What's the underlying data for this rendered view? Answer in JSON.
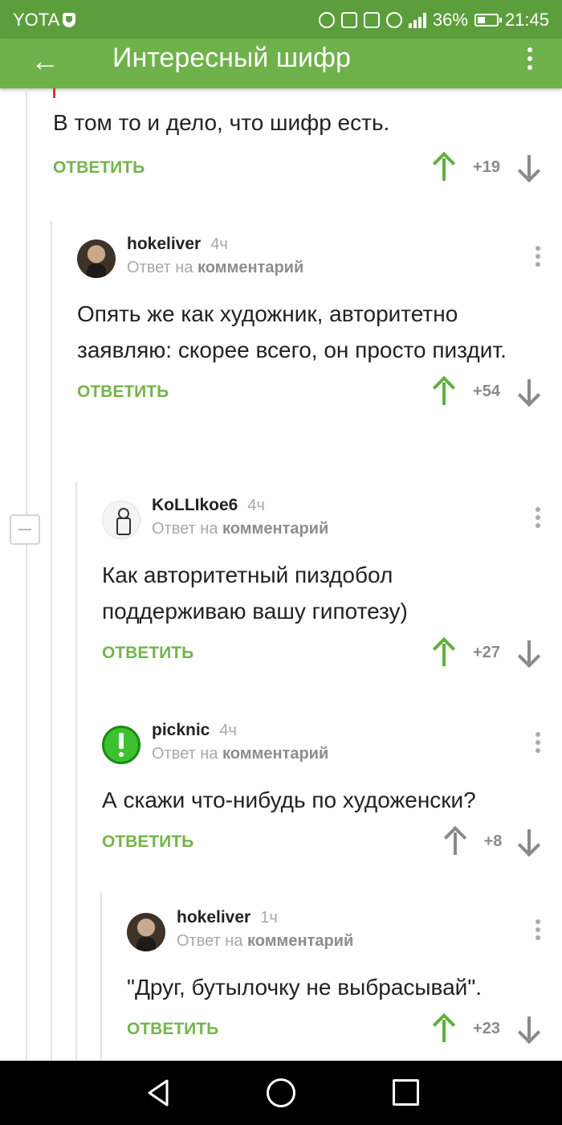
{
  "status_bar": {
    "carrier": "YOTA",
    "battery": "36%",
    "battery_level": 0.36,
    "time": "21:45",
    "icons": [
      "shield-icon",
      "headphones-icon",
      "nfc-icon",
      "vibrate-icon",
      "alarm-icon",
      "signal-4g-icon",
      "battery-icon"
    ]
  },
  "app_bar": {
    "title": "Интересный шифр",
    "back_icon": "arrow-left-icon",
    "more_icon": "more-vertical-icon"
  },
  "top_comment": {
    "text": "В том то и дело, что шифр есть.",
    "reply_label": "ОТВЕТИТЬ",
    "score": "+19",
    "upvote_color": "#5fb13a"
  },
  "comments": [
    {
      "username": "hokeliver",
      "time": "4ч",
      "reply_prefix": "Ответ на",
      "reply_target": "комментарий",
      "text": "Опять же как художник, авторитетно заявляю: скорее всего, он просто пиздит.",
      "reply_label": "ОТВЕТИТЬ",
      "score": "+54"
    },
    {
      "username": "KoLLIkoe6",
      "time": "4ч",
      "reply_prefix": "Ответ на",
      "reply_target": "комментарий",
      "text": "Как авторитетный пиздобол поддерживаю вашу гипотезу)",
      "reply_label": "ОТВЕТИТЬ",
      "score": "+27"
    },
    {
      "username": "picknic",
      "time": "4ч",
      "reply_prefix": "Ответ на",
      "reply_target": "комментарий",
      "text": "А скажи что-нибудь по художенски?",
      "reply_label": "ОТВЕТИТЬ",
      "score": "+8"
    },
    {
      "username": "hokeliver",
      "time": "1ч",
      "reply_prefix": "Ответ на",
      "reply_target": "комментарий",
      "text": "\"Друг, бутылочку не выбрасывай\".",
      "reply_label": "ОТВЕТИТЬ",
      "score": "+23"
    }
  ],
  "colors": {
    "status_bar": "#5d9e3c",
    "app_bar": "#6fb14a",
    "reply_green": "#74b54b",
    "upvote_green": "#5fb13a",
    "neutral_gray": "#8a8a8a"
  }
}
